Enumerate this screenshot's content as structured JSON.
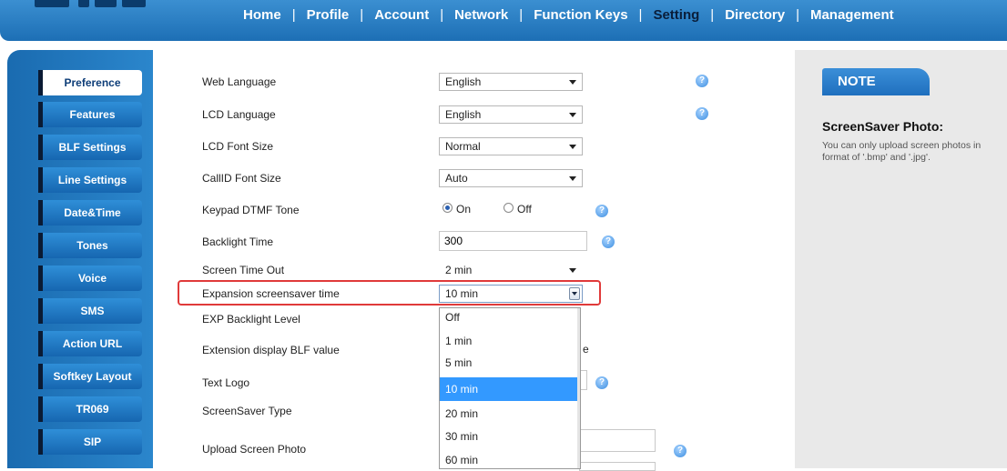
{
  "nav": {
    "items": [
      "Home",
      "Profile",
      "Account",
      "Network",
      "Function Keys",
      "Setting",
      "Directory",
      "Management"
    ],
    "active": "Setting"
  },
  "sidebar": {
    "items": [
      "Preference",
      "Features",
      "BLF Settings",
      "Line Settings",
      "Date&Time",
      "Tones",
      "Voice",
      "SMS",
      "Action URL",
      "Softkey Layout",
      "TR069",
      "SIP"
    ],
    "active": "Preference"
  },
  "form": {
    "web_language": {
      "label": "Web Language",
      "value": "English"
    },
    "lcd_language": {
      "label": "LCD Language",
      "value": "English"
    },
    "lcd_font_size": {
      "label": "LCD Font Size",
      "value": "Normal"
    },
    "callid_font_size": {
      "label": "CallID Font Size",
      "value": "Auto"
    },
    "keypad_dtmf_tone": {
      "label": "Keypad DTMF Tone",
      "on_label": "On",
      "off_label": "Off",
      "selected": "On"
    },
    "backlight_time": {
      "label": "Backlight Time",
      "value": "300"
    },
    "screen_time_out": {
      "label": "Screen Time Out",
      "value": "2 min"
    },
    "expansion_screensaver_time": {
      "label": "Expansion screensaver time",
      "value": "10 min"
    },
    "exp_backlight_level": {
      "label": "EXP Backlight Level"
    },
    "extension_display_blf_value": {
      "label": "Extension display BLF value",
      "partial_text": "e"
    },
    "text_logo": {
      "label": "Text Logo"
    },
    "screensaver_type": {
      "label": "ScreenSaver Type"
    },
    "upload_screen_photo": {
      "label": "Upload Screen Photo"
    },
    "help_glyph": "?"
  },
  "dropdown": {
    "options": [
      "Off",
      "1 min",
      "5 min",
      "10 min",
      "20 min",
      "30 min",
      "60 min"
    ],
    "selected": "10 min"
  },
  "note": {
    "badge": "NOTE",
    "heading": "ScreenSaver Photo:",
    "body": "You can only upload screen photos in format of '.bmp' and '.jpg'."
  },
  "colors": {
    "nav_blue": "#2a7fc4",
    "sidebar_blue": "#1f75bd",
    "highlight_red": "#e03a3a",
    "selected_option": "#3399ff",
    "note_bg": "#e9e9e9"
  }
}
